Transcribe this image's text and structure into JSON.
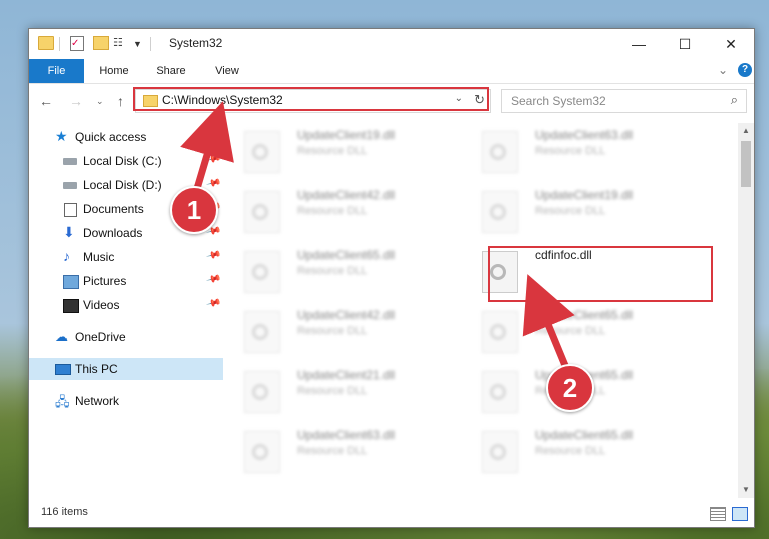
{
  "window": {
    "title": "System32",
    "controls": {
      "minimize": "—",
      "maximize": "☐",
      "close": "✕"
    }
  },
  "ribbon": {
    "tabs": [
      {
        "label": "File",
        "active": true
      },
      {
        "label": "Home"
      },
      {
        "label": "Share"
      },
      {
        "label": "View"
      }
    ],
    "help": "?"
  },
  "nav": {
    "back": "←",
    "forward": "→",
    "recent": "⌄",
    "up": "↑",
    "address": "C:\\Windows\\System32",
    "refresh": "↻",
    "search_placeholder": "Search System32"
  },
  "sidebar": {
    "items": [
      {
        "label": "Quick access",
        "icon": "star-icon",
        "pinned": false
      },
      {
        "label": "Local Disk (C:)",
        "icon": "drive-icon",
        "pinned": true
      },
      {
        "label": "Local Disk (D:)",
        "icon": "drive-icon",
        "pinned": true
      },
      {
        "label": "Documents",
        "icon": "document-icon",
        "pinned": true
      },
      {
        "label": "Downloads",
        "icon": "download-icon",
        "pinned": true
      },
      {
        "label": "Music",
        "icon": "music-icon",
        "pinned": true
      },
      {
        "label": "Pictures",
        "icon": "pictures-icon",
        "pinned": true
      },
      {
        "label": "Videos",
        "icon": "video-icon",
        "pinned": true
      },
      {
        "label": "OneDrive",
        "icon": "cloud-icon"
      },
      {
        "label": "This PC",
        "icon": "computer-icon",
        "selected": true
      },
      {
        "label": "Network",
        "icon": "network-icon"
      }
    ]
  },
  "files": [
    {
      "name": "UpdateClient19.dll",
      "type": "Resource DLL",
      "blurred": true
    },
    {
      "name": "UpdateClient63.dll",
      "type": "Resource DLL",
      "blurred": true
    },
    {
      "name": "UpdateClient42.dll",
      "type": "Resource DLL",
      "blurred": true
    },
    {
      "name": "UpdateClient19.dll",
      "type": "Resource DLL",
      "blurred": true
    },
    {
      "name": "UpdateClient65.dll",
      "type": "Resource DLL",
      "blurred": true
    },
    {
      "name": "cdfinfoc.dll",
      "type": "",
      "blurred": false,
      "highlighted": true
    },
    {
      "name": "UpdateClient42.dll",
      "type": "Resource DLL",
      "blurred": true
    },
    {
      "name": "UpdateClient65.dll",
      "type": "Resource DLL",
      "blurred": true
    },
    {
      "name": "UpdateClient21.dll",
      "type": "Resource DLL",
      "blurred": true
    },
    {
      "name": "UpdateClient65.dll",
      "type": "Resource DLL",
      "blurred": true
    },
    {
      "name": "UpdateClient63.dll",
      "type": "Resource DLL",
      "blurred": true
    },
    {
      "name": "UpdateClient65.dll",
      "type": "Resource DLL",
      "blurred": true
    }
  ],
  "status": {
    "items_count": "116 items"
  },
  "annotations": {
    "step1": "1",
    "step2": "2",
    "color": "#d9363e"
  }
}
